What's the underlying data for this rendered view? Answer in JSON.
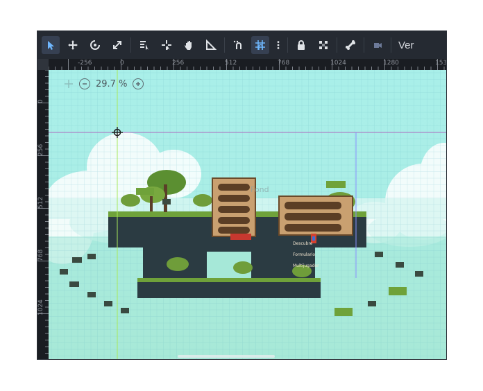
{
  "toolbar": {
    "tools": [
      {
        "name": "select-tool",
        "icon": "arrow-pointer-icon",
        "active": true
      },
      {
        "name": "move-tool",
        "icon": "move-icon"
      },
      {
        "name": "rotate-tool",
        "icon": "rotate-icon"
      },
      {
        "name": "scale-tool",
        "icon": "scale-icon"
      },
      {
        "name": "list-select-tool",
        "icon": "list-select-icon"
      },
      {
        "name": "pivot-tool",
        "icon": "pivot-icon"
      },
      {
        "name": "pan-tool",
        "icon": "hand-icon"
      },
      {
        "name": "ruler-tool",
        "icon": "ruler-icon"
      },
      {
        "name": "smart-snap-toggle",
        "icon": "smart-snap-icon"
      },
      {
        "name": "grid-snap-toggle",
        "icon": "grid-snap-icon",
        "active": true
      },
      {
        "name": "snap-options-menu",
        "icon": "more-vertical-icon"
      },
      {
        "name": "lock-button",
        "icon": "lock-icon"
      },
      {
        "name": "group-button",
        "icon": "group-icon"
      },
      {
        "name": "skeleton-button",
        "icon": "bone-icon"
      },
      {
        "name": "camera-override-button",
        "icon": "camera-icon"
      }
    ],
    "view_menu_label": "Ver",
    "accent_color": "#4f9ef8"
  },
  "rulers": {
    "top_labels": [
      "-256",
      "0",
      "256",
      "512",
      "768",
      "1024",
      "1280",
      "153"
    ],
    "left_labels": [
      "0",
      "256",
      "512",
      "768",
      "1024"
    ]
  },
  "viewport": {
    "zoom_level": "29.7 %",
    "ghost_text": "Fond",
    "menu_panel_right": [
      "Descubre",
      "Formulario",
      "Multijugador"
    ]
  },
  "colors": {
    "sky_top": "#a9efe9",
    "sky_bottom": "#a6e8d2",
    "grass": "#6fa23a",
    "ground": "#2a3a40",
    "sign_wood": "#c9a070"
  }
}
